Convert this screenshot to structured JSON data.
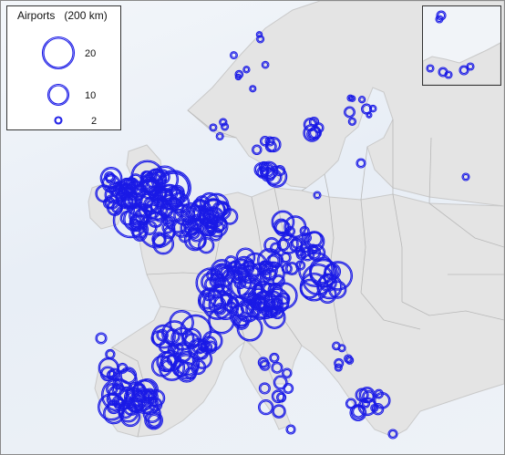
{
  "legend": {
    "title": "Airports",
    "scale_note": "(200 km)",
    "sizes": [
      {
        "label": "20",
        "value": 20
      },
      {
        "label": "10",
        "value": 10
      },
      {
        "label": "2",
        "value": 2
      }
    ]
  },
  "colors": {
    "symbol": "#1a1ae6",
    "land": "#e4e4e4",
    "border": "#b8b8b8",
    "coast_highlight": "#c9c9c9",
    "sea": "#eef2f7"
  },
  "symbols": {
    "type": "proportional-circle",
    "measure": "airports within 200 km"
  }
}
